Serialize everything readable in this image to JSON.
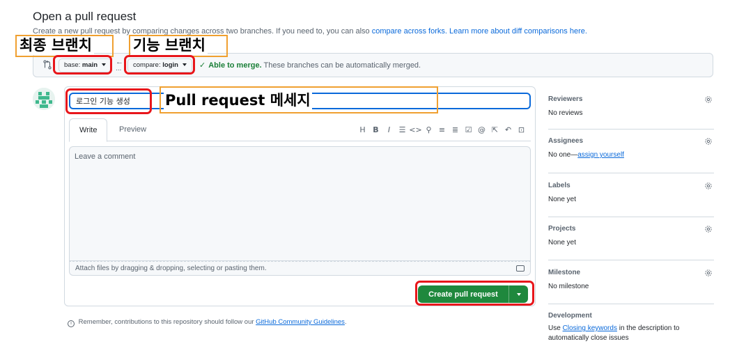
{
  "page": {
    "title": "Open a pull request",
    "subtitle_prefix": "Create a new pull request by comparing changes across two branches. If you need to, you can also",
    "subtitle_link1": "compare across forks.",
    "subtitle_link2": "Learn more about diff comparisons here."
  },
  "compare": {
    "base_prefix": "base:",
    "base_branch": "main",
    "compare_prefix": "compare:",
    "compare_branch": "login",
    "arrow": "←",
    "ellipsis": "...",
    "merge_ok": "Able to merge.",
    "merge_text": "These branches can be automatically merged."
  },
  "form": {
    "title_value": "로그인 기능 생성",
    "tabs": [
      "Write",
      "Preview"
    ],
    "toolbar_icons": [
      "heading-icon",
      "bold-icon",
      "italic-icon",
      "quote-icon",
      "code-icon",
      "link-icon",
      "unordered-list-icon",
      "ordered-list-icon",
      "task-list-icon",
      "mention-icon",
      "reference-icon",
      "undo-icon",
      "fullscreen-icon"
    ],
    "comment_placeholder": "Leave a comment",
    "attach_text": "Attach files by dragging & dropping, selecting or pasting them.",
    "create_label": "Create pull request"
  },
  "footnote": {
    "prefix": "Remember, contributions to this repository should follow our",
    "link": "GitHub Community Guidelines",
    "suffix": "."
  },
  "sidebar": {
    "reviewers": {
      "head": "Reviewers",
      "value": "No reviews"
    },
    "assignees": {
      "head": "Assignees",
      "value_prefix": "No one—",
      "value_link": "assign yourself"
    },
    "labels": {
      "head": "Labels",
      "value": "None yet"
    },
    "projects": {
      "head": "Projects",
      "value": "None yet"
    },
    "milestone": {
      "head": "Milestone",
      "value": "No milestone"
    },
    "development": {
      "head": "Development",
      "value_prefix": "Use",
      "value_link": "Closing keywords",
      "value_suffix": "in the description to automatically close issues"
    }
  },
  "annotations": {
    "base_label": "최종 브랜치",
    "compare_label": "기능 브랜치",
    "title_label": "Pull request 메세지"
  },
  "colors": {
    "accent": "#0969da",
    "success": "#1f883d",
    "annotation_red": "#e8161b",
    "annotation_orange": "#f0a030"
  }
}
